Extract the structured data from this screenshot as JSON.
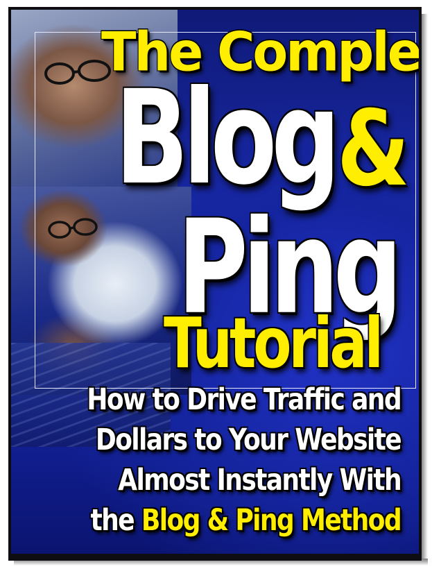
{
  "cover": {
    "title_line1": "The Complete",
    "title_blog": "Blog",
    "title_amp": "&",
    "title_ping": "Ping",
    "title_tutorial": "Tutorial",
    "subtitle_line1": "How to Drive Traffic and",
    "subtitle_line2": "Dollars to Your Website",
    "subtitle_line3": "Almost Instantly With",
    "subtitle_line4_prefix": "the",
    "subtitle_line4_highlight": "Blog & Ping Method"
  },
  "colors": {
    "accent_yellow": "#ffee00",
    "title_white": "#ffffff",
    "background_blue": "#1a2aa8",
    "outline_black": "#000000"
  }
}
